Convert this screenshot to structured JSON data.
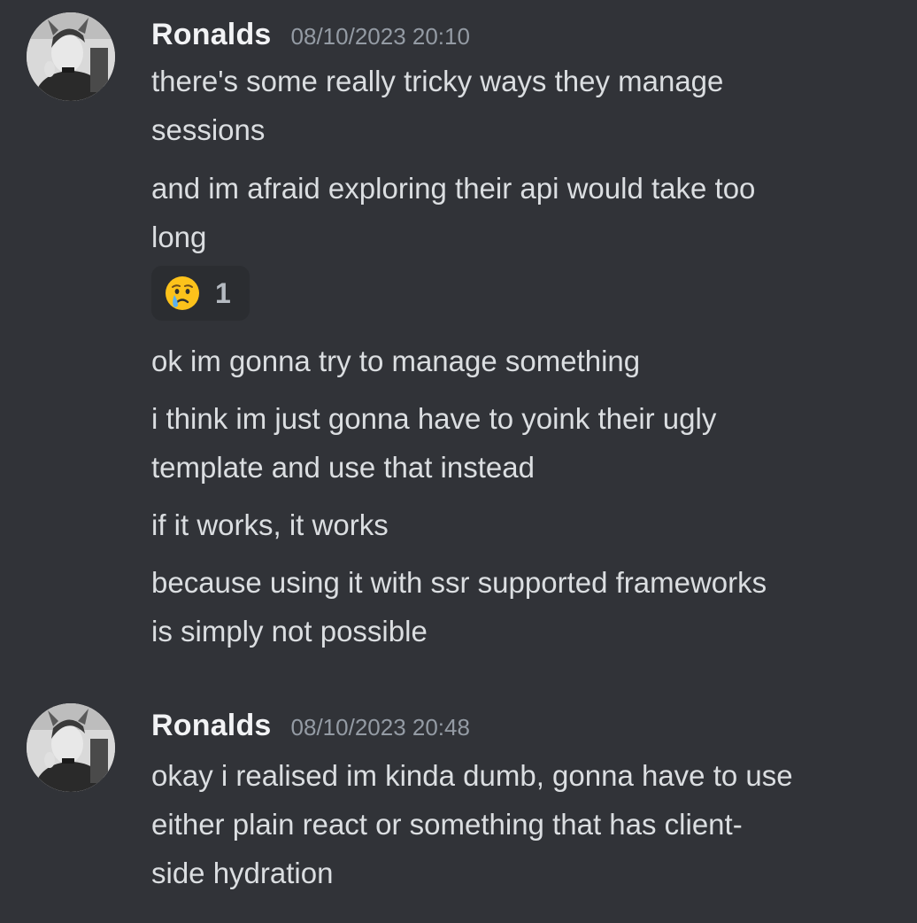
{
  "messages": [
    {
      "author": "Ronalds",
      "timestamp": "08/10/2023 20:10",
      "lines": [
        "there's some really tricky ways they manage",
        "sessions",
        "and im afraid exploring their api would take too",
        "long",
        "ok im gonna try to manage something",
        "i think im just gonna have to yoink their ugly",
        "template and use that instead",
        "if it works, it works",
        "because using it with ssr supported frameworks",
        "is simply not possible"
      ],
      "reaction": {
        "emoji": "crying-face",
        "count": "1"
      }
    },
    {
      "author": "Ronalds",
      "timestamp": "08/10/2023 20:48",
      "lines": [
        "okay i realised im kinda dumb, gonna have to use",
        "either plain react or something that has client-",
        "side hydration"
      ]
    }
  ],
  "colors": {
    "background": "#313338",
    "username": "#f2f3f5",
    "timestamp": "#949ba4",
    "message_text": "#dbdee1",
    "reaction_bg": "#2b2d31"
  }
}
